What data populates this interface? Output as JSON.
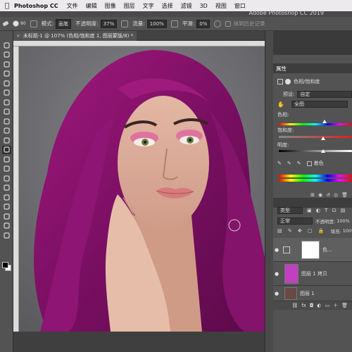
{
  "menubar": {
    "app_name": "Photoshop CC",
    "items": [
      "文件",
      "编辑",
      "图像",
      "图层",
      "文字",
      "选择",
      "滤镜",
      "3D",
      "视图",
      "窗口"
    ]
  },
  "window": {
    "app_title": "Adobe Photoshop CC 2019"
  },
  "options_bar": {
    "brush_size": "80",
    "mode_label": "模式:",
    "mode_value": "画笔",
    "opacity_label": "不透明度:",
    "opacity_value": "37%",
    "flow_label": "流量:",
    "flow_value": "100%",
    "smooth_label": "平滑:",
    "smooth_value": "0%",
    "erase_history": "抹到历史记录"
  },
  "document": {
    "tab_title": "未标题-1 @ 107% (色相/饱和度 1, 图层蒙版/8) *"
  },
  "properties": {
    "title": "属性",
    "adjustment_name": "色相/饱和度",
    "preset_label": "预设:",
    "preset_value": "自定",
    "channel_value": "全图",
    "hue_label": "色相:",
    "saturation_label": "饱和度:",
    "lightness_label": "明度:",
    "colorize_label": "着色"
  },
  "layers": {
    "filter_value": "类型",
    "blend_mode": "正常",
    "opacity_label": "不透明度:",
    "opacity_value": "100%",
    "fill_label": "填充:",
    "fill_value": "100%",
    "items": [
      {
        "name": "色..."
      },
      {
        "name": "图层 1 拷贝"
      },
      {
        "name": "图层 1"
      }
    ]
  },
  "colors": {
    "accent": "#ff00ff",
    "hair": "#8a1470",
    "panel": "#535353"
  }
}
